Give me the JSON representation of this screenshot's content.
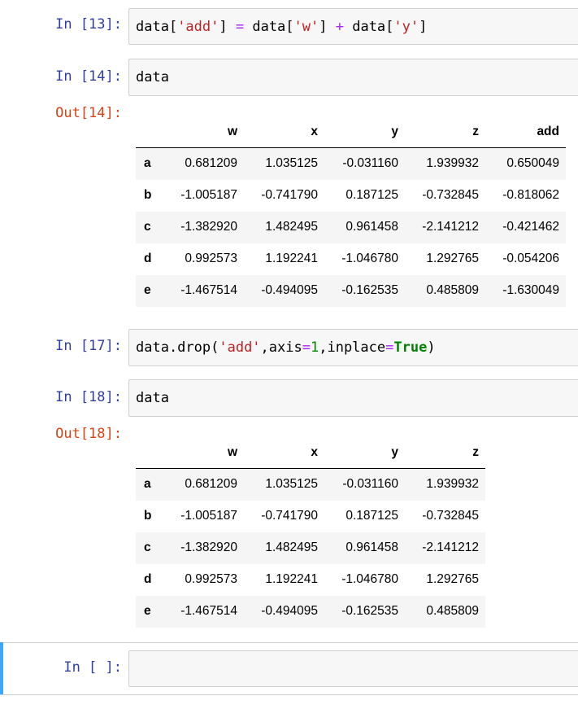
{
  "cells": [
    {
      "in_prompt": "In [13]:",
      "code_tokens": [
        {
          "t": "data[",
          "c": "plain"
        },
        {
          "t": "'add'",
          "c": "str"
        },
        {
          "t": "] ",
          "c": "plain"
        },
        {
          "t": "=",
          "c": "op"
        },
        {
          "t": " data[",
          "c": "plain"
        },
        {
          "t": "'w'",
          "c": "str"
        },
        {
          "t": "] ",
          "c": "plain"
        },
        {
          "t": "+",
          "c": "op"
        },
        {
          "t": " data[",
          "c": "plain"
        },
        {
          "t": "'y'",
          "c": "str"
        },
        {
          "t": "]",
          "c": "plain"
        }
      ]
    },
    {
      "in_prompt": "In [14]:",
      "code_tokens": [
        {
          "t": "data",
          "c": "plain"
        }
      ],
      "out_prompt": "Out[14]:",
      "table": {
        "columns": [
          "w",
          "x",
          "y",
          "z",
          "add"
        ],
        "rows": [
          {
            "index": "a",
            "values": [
              "0.681209",
              "1.035125",
              "-0.031160",
              "1.939932",
              "0.650049"
            ]
          },
          {
            "index": "b",
            "values": [
              "-1.005187",
              "-0.741790",
              "0.187125",
              "-0.732845",
              "-0.818062"
            ]
          },
          {
            "index": "c",
            "values": [
              "-1.382920",
              "1.482495",
              "0.961458",
              "-2.141212",
              "-0.421462"
            ]
          },
          {
            "index": "d",
            "values": [
              "0.992573",
              "1.192241",
              "-1.046780",
              "1.292765",
              "-0.054206"
            ]
          },
          {
            "index": "e",
            "values": [
              "-1.467514",
              "-0.494095",
              "-0.162535",
              "0.485809",
              "-1.630049"
            ]
          }
        ]
      }
    },
    {
      "in_prompt": "In [17]:",
      "code_tokens": [
        {
          "t": "data.drop(",
          "c": "plain"
        },
        {
          "t": "'add'",
          "c": "str"
        },
        {
          "t": ",axis",
          "c": "plain"
        },
        {
          "t": "=",
          "c": "op"
        },
        {
          "t": "1",
          "c": "num"
        },
        {
          "t": ",inplace",
          "c": "plain"
        },
        {
          "t": "=",
          "c": "op"
        },
        {
          "t": "True",
          "c": "kw"
        },
        {
          "t": ")",
          "c": "plain"
        }
      ]
    },
    {
      "in_prompt": "In [18]:",
      "code_tokens": [
        {
          "t": "data",
          "c": "plain"
        }
      ],
      "out_prompt": "Out[18]:",
      "table": {
        "columns": [
          "w",
          "x",
          "y",
          "z"
        ],
        "rows": [
          {
            "index": "a",
            "values": [
              "0.681209",
              "1.035125",
              "-0.031160",
              "1.939932"
            ]
          },
          {
            "index": "b",
            "values": [
              "-1.005187",
              "-0.741790",
              "0.187125",
              "-0.732845"
            ]
          },
          {
            "index": "c",
            "values": [
              "-1.382920",
              "1.482495",
              "0.961458",
              "-2.141212"
            ]
          },
          {
            "index": "d",
            "values": [
              "0.992573",
              "1.192241",
              "-1.046780",
              "1.292765"
            ]
          },
          {
            "index": "e",
            "values": [
              "-1.467514",
              "-0.494095",
              "-0.162535",
              "0.485809"
            ]
          }
        ]
      }
    },
    {
      "in_prompt": "In [ ]:",
      "code_tokens": []
    }
  ],
  "colors": {
    "in_prompt": "#303f9f",
    "out_prompt": "#d84315",
    "string": "#ba2121",
    "operator": "#aa22ff",
    "number": "#008800",
    "keyword": "#008000",
    "active_cell_bar": "#42a5f5"
  }
}
